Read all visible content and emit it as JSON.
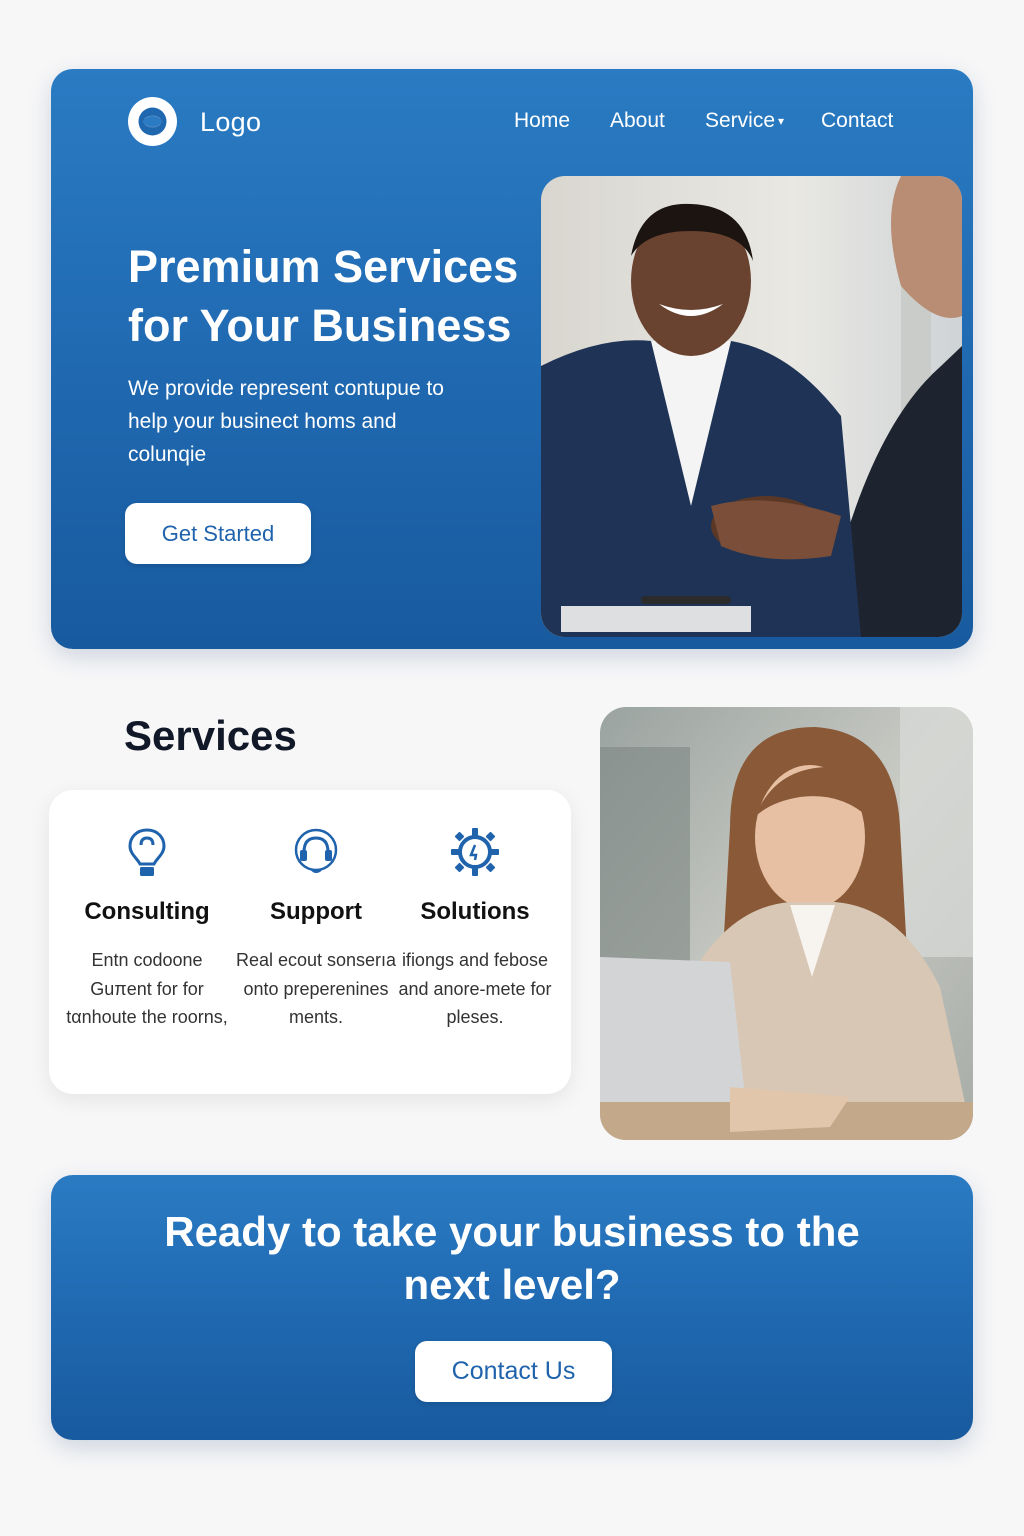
{
  "brand": {
    "logo_text": "Logo"
  },
  "nav": {
    "items": [
      {
        "label": "Home"
      },
      {
        "label": "About"
      },
      {
        "label": "Service"
      },
      {
        "label": "Contact"
      }
    ]
  },
  "hero": {
    "title": "Premium Services for Your Business",
    "description": "We provide represent contupue to help your businect homs and colunqie",
    "cta_label": "Get Started"
  },
  "services": {
    "heading": "Services",
    "items": [
      {
        "name": "Consulting",
        "description": "Entn codoone Guπent for for tαnhoute the roorns,",
        "icon": "lightbulb-icon"
      },
      {
        "name": "Support",
        "description": "Real ecout sonserıa onto preperenines ments.",
        "icon": "headset-icon"
      },
      {
        "name": "Solutions",
        "description": "ifiongs and febose and anore-mete for pleses.",
        "icon": "gear-icon"
      }
    ]
  },
  "cta": {
    "title": "Ready to take your business to the next level?",
    "button_label": "Contact Us"
  },
  "colors": {
    "primary_blue": "#1f68b0",
    "accent_text": "#1f63ad",
    "background": "#f7f7f8"
  }
}
